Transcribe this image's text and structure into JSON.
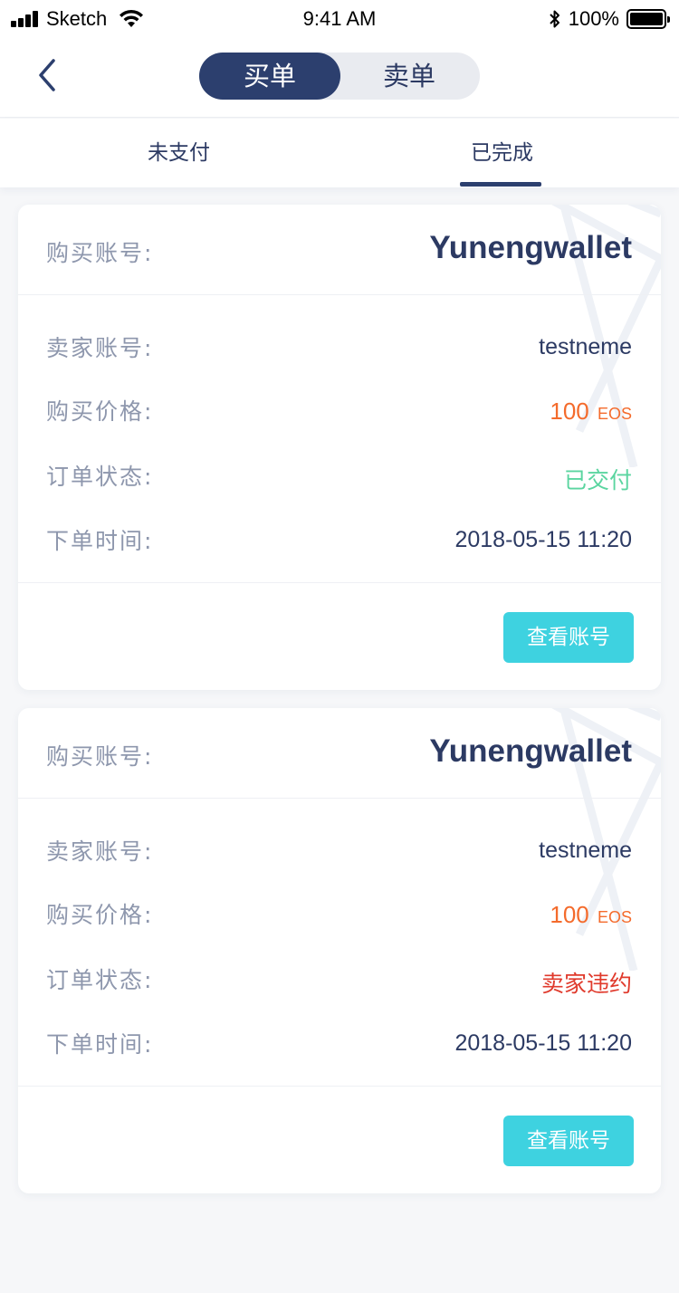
{
  "status_bar": {
    "carrier": "Sketch",
    "time": "9:41 AM",
    "battery": "100%"
  },
  "nav": {
    "segments": [
      {
        "label": "买单",
        "active": true
      },
      {
        "label": "卖单",
        "active": false
      }
    ]
  },
  "tabs": [
    {
      "label": "未支付",
      "active": false
    },
    {
      "label": "已完成",
      "active": true
    }
  ],
  "orders": [
    {
      "buyer_label": "购买账号:",
      "buyer": "Yunengwallet",
      "seller_label": "卖家账号:",
      "seller": "testneme",
      "price_label": "购买价格:",
      "price": "100",
      "unit": "EOS",
      "status_label": "订单状态:",
      "status": "已交付",
      "status_color": "#5bd5a0",
      "time_label": "下单时间:",
      "time": "2018-05-15 11:20",
      "button": "查看账号"
    },
    {
      "buyer_label": "购买账号:",
      "buyer": "Yunengwallet",
      "seller_label": "卖家账号:",
      "seller": "testneme",
      "price_label": "购买价格:",
      "price": "100",
      "unit": "EOS",
      "status_label": "订单状态:",
      "status": "卖家违约",
      "status_color": "#e03a2c",
      "time_label": "下单时间:",
      "time": "2018-05-15 11:20",
      "button": "查看账号"
    }
  ],
  "colors": {
    "primary": "#2c3f6e",
    "price": "#f46b2c",
    "button": "#3ed2e0"
  },
  "icons": [
    "signal-icon",
    "wifi-icon",
    "bluetooth-icon",
    "battery-icon",
    "back-icon"
  ]
}
